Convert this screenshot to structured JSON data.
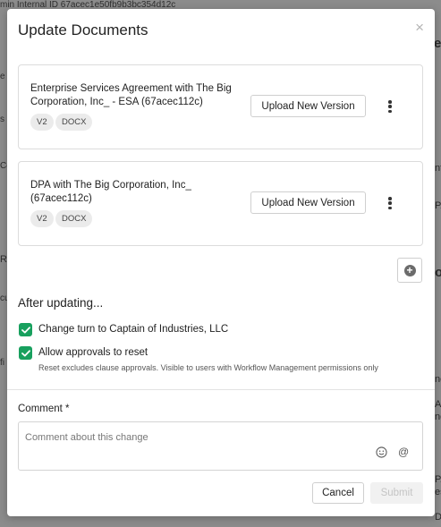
{
  "background": {
    "top_text": "min Internal ID 67acec1e50fb9b3bc354d12c",
    "left_fragments": [
      "e",
      "s",
      "Co",
      "Re",
      "cu",
      "fi"
    ],
    "right_fragments": [
      "ec",
      "nt",
      "PA",
      "op",
      "ne",
      "Ap",
      "ne",
      "PA",
      "es",
      "DP"
    ]
  },
  "modal": {
    "title": "Update Documents",
    "close_symbol": "×",
    "documents": [
      {
        "title": "Enterprise Services Agreement with The Big Corporation, Inc_ - ESA (67acec112c)",
        "version": "V2",
        "format": "DOCX",
        "upload_label": "Upload New Version"
      },
      {
        "title": "DPA with The Big Corporation, Inc_ (67acec112c)",
        "version": "V2",
        "format": "DOCX",
        "upload_label": "Upload New Version"
      }
    ],
    "after_updating": {
      "title": "After updating...",
      "options": [
        {
          "label": "Change turn to Captain of Industries, LLC",
          "checked": true
        },
        {
          "label": "Allow approvals to reset",
          "checked": true
        }
      ],
      "help_text": "Reset excludes clause approvals. Visible to users with Workflow Management permissions only"
    },
    "comment": {
      "label": "Comment *",
      "placeholder": "Comment about this change",
      "value": ""
    },
    "footer": {
      "cancel_label": "Cancel",
      "submit_label": "Submit"
    },
    "colors": {
      "checkbox": "#18a05e",
      "overlay": "#8c8c8c"
    }
  }
}
